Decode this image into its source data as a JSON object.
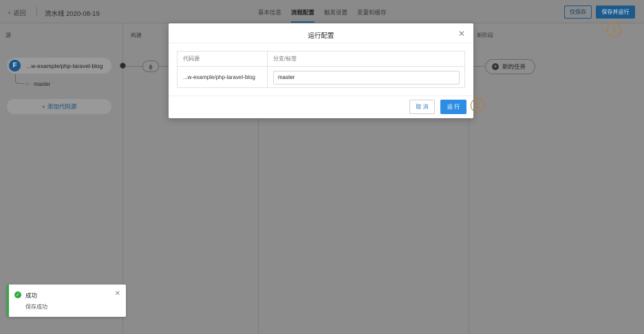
{
  "header": {
    "back_icon": "chevron-left-icon",
    "back_label": "返回",
    "pipeline_title": "流水线 2020-08-19",
    "tabs": [
      {
        "label": "基本信息",
        "active": false
      },
      {
        "label": "流程配置",
        "active": true
      },
      {
        "label": "触发设置",
        "active": false
      },
      {
        "label": "变量和缓存",
        "active": false
      }
    ],
    "save_only_label": "仅保存",
    "save_run_label": "保存并运行",
    "accent_color": "#1c5a8c"
  },
  "annotations": {
    "marker_1": "1",
    "marker_2": "2",
    "marker_color": "#e6a23c"
  },
  "stages": {
    "source_header": "源",
    "build_header": "构建",
    "new_stage_header": "新阶段",
    "source_name": "...w-example/php-laravel-blog",
    "source_logo_letter": "F",
    "branch": "master",
    "branch_icon": "branch-icon",
    "add_source_label": "添加代码源",
    "add_source_icon": "plus-icon",
    "build_node_icon": "lightning-icon",
    "new_task_label": "新的任务",
    "new_task_icon": "plus-circle-icon"
  },
  "modal": {
    "title": "运行配置",
    "close_icon": "close-icon",
    "columns": [
      "代码源",
      "分支/标签"
    ],
    "rows": [
      {
        "source": "...w-example/php-laravel-blog",
        "branch": "master"
      }
    ],
    "cancel_label": "取 消",
    "run_label": "运 行",
    "primary_color": "#2d8ce3"
  },
  "toast": {
    "icon": "check-circle-icon",
    "title": "成功",
    "message": "保存成功",
    "close_icon": "close-icon",
    "color": "#2eaa3e"
  }
}
